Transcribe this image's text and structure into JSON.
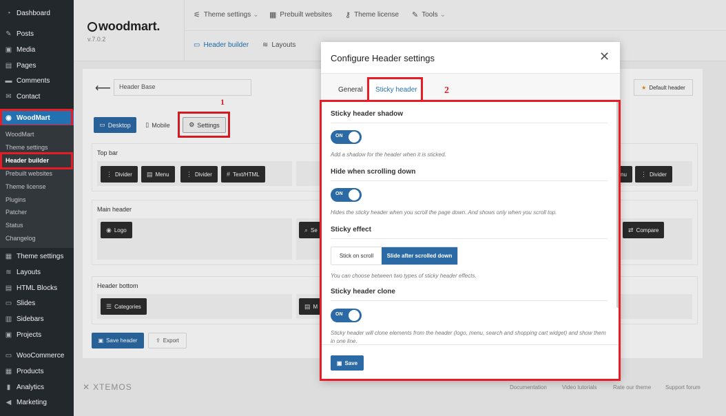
{
  "wp_menu": {
    "top_items": [
      {
        "label": "Dashboard",
        "icon": "dashboard-icon"
      },
      {
        "label": "Posts",
        "icon": "pin-icon"
      },
      {
        "label": "Media",
        "icon": "media-icon"
      },
      {
        "label": "Pages",
        "icon": "page-icon"
      },
      {
        "label": "Comments",
        "icon": "comment-icon"
      },
      {
        "label": "Contact",
        "icon": "mail-icon"
      }
    ],
    "woodmart_label": "WoodMart",
    "woodmart_sub": [
      "WoodMart",
      "Theme settings",
      "Header builder",
      "Prebuilt websites",
      "Theme license",
      "Plugins",
      "Patcher",
      "Status",
      "Changelog"
    ],
    "bottom_items": [
      {
        "label": "Theme settings",
        "icon": "settings-icon"
      },
      {
        "label": "Layouts",
        "icon": "layers-icon"
      },
      {
        "label": "HTML Blocks",
        "icon": "html-icon"
      },
      {
        "label": "Slides",
        "icon": "slides-icon"
      },
      {
        "label": "Sidebars",
        "icon": "sidebar-icon"
      },
      {
        "label": "Projects",
        "icon": "projects-icon"
      },
      {
        "label": "WooCommerce",
        "icon": "woo-icon"
      },
      {
        "label": "Products",
        "icon": "products-icon"
      },
      {
        "label": "Analytics",
        "icon": "analytics-icon"
      },
      {
        "label": "Marketing",
        "icon": "megaphone-icon"
      }
    ]
  },
  "brand": {
    "logo": "woodmart.",
    "version": "v.7.0.2"
  },
  "top_nav": [
    "Theme settings",
    "Prebuilt websites",
    "Theme license",
    "Tools"
  ],
  "sub_nav": [
    "Header builder",
    "Layouts"
  ],
  "builder": {
    "header_name": "Header Base",
    "default_header": "Default header",
    "devices": [
      "Desktop",
      "Mobile",
      "Settings"
    ],
    "rows": {
      "top_bar": {
        "title": "Top bar",
        "chips_left": [
          "Divider",
          "Menu",
          "Divider",
          "Text/HTML"
        ],
        "chips_right": [
          "nu",
          "Divider"
        ]
      },
      "main_header": {
        "title": "Main header",
        "chips": [
          "Logo",
          "Se",
          "Compare"
        ]
      },
      "header_bottom": {
        "title": "Header bottom",
        "chips": [
          "Categories",
          "M"
        ]
      }
    },
    "save_label": "Save header",
    "export_label": "Export"
  },
  "footer": {
    "brand": "XTEMOS",
    "links": [
      "Documentation",
      "Video tutorials",
      "Rate our theme",
      "Support forum"
    ]
  },
  "annotations": {
    "one": "1",
    "two": "2",
    "color": "#e81c24"
  },
  "modal": {
    "title": "Configure Header settings",
    "tabs": [
      "General",
      "Sticky header"
    ],
    "sections": {
      "shadow": {
        "title": "Sticky header shadow",
        "toggle": "ON",
        "hint": "Add a shadow for the header when it is sticked."
      },
      "hide": {
        "title": "Hide when scrolling down",
        "toggle": "ON",
        "hint": "Hides the sticky header when you scroll the page down. And shows only when you scroll top."
      },
      "effect": {
        "title": "Sticky effect",
        "options": [
          "Stick on scroll",
          "Slide after scrolled down"
        ],
        "selected": "Slide after scrolled down",
        "hint": "You can choose between two types of sticky header effects."
      },
      "clone": {
        "title": "Sticky header clone",
        "toggle": "ON",
        "hint": "Sticky header will clone elements from the header (logo, menu, search and shopping cart widget) and show them in one line."
      }
    },
    "save_label": "Save"
  },
  "colors": {
    "accent": "#2b6aa5",
    "wp_sidebar": "#23282d",
    "annotation": "#e81c24"
  }
}
